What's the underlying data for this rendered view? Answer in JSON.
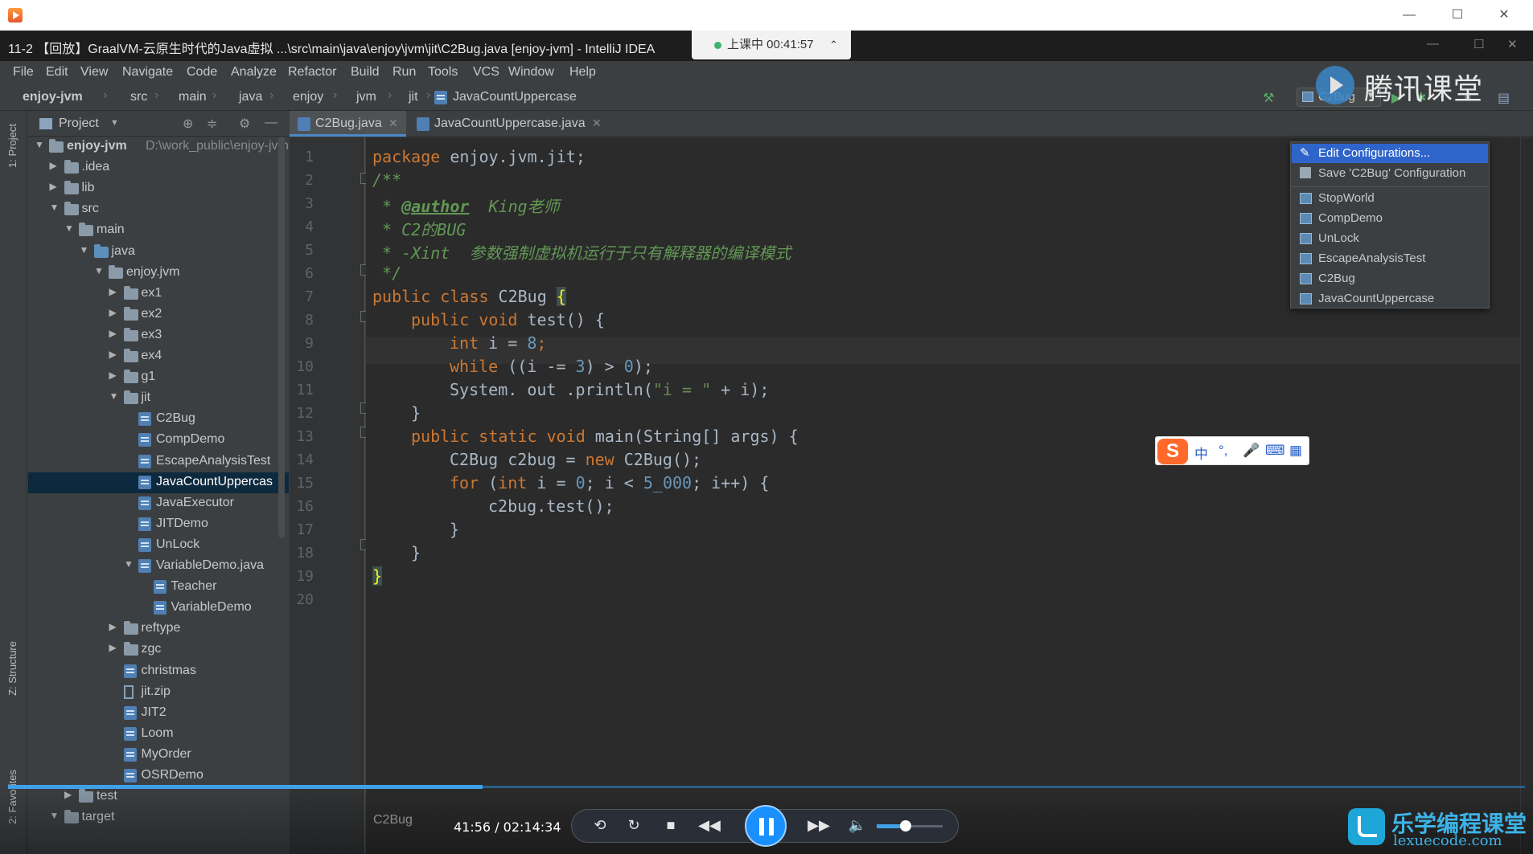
{
  "player": {
    "window_controls": {
      "minimize": "—",
      "maximize": "☐",
      "close": "✕"
    },
    "time": "41:56 / 02:14:34",
    "progress_fraction": 0.313,
    "volume_fraction": 0.44,
    "file_label": "C2Bug"
  },
  "ide": {
    "title": "11-2 【回放】GraalVM-云原生时代的Java虚拟 ...\\src\\main\\java\\enjoy\\jvm\\jit\\C2Bug.java [enjoy-jvm] - IntelliJ IDEA",
    "live_badge": "上课中 00:41:57",
    "menu": [
      "File",
      "Edit",
      "View",
      "Navigate",
      "Code",
      "Analyze",
      "Refactor",
      "Build",
      "Run",
      "Tools",
      "VCS",
      "Window",
      "Help"
    ],
    "breadcrumb": [
      "enjoy-jvm",
      "src",
      "main",
      "java",
      "enjoy",
      "jvm",
      "jit",
      "JavaCountUppercase"
    ],
    "run_config": "C2Bug",
    "left_tabs": {
      "project": "1: Project",
      "structure": "Z: Structure",
      "favorites": "2: Favorites"
    },
    "project_title": "Project",
    "tree": [
      {
        "label": "enjoy-jvm",
        "path": "D:\\work_public\\enjoy-jvm",
        "depth": 0,
        "arrow": "open",
        "icon": "folder",
        "bold": true
      },
      {
        "label": ".idea",
        "depth": 1,
        "arrow": "closed",
        "icon": "folder"
      },
      {
        "label": "lib",
        "depth": 1,
        "arrow": "closed",
        "icon": "folder"
      },
      {
        "label": "src",
        "depth": 1,
        "arrow": "open",
        "icon": "folder"
      },
      {
        "label": "main",
        "depth": 2,
        "arrow": "open",
        "icon": "folder"
      },
      {
        "label": "java",
        "depth": 3,
        "arrow": "open",
        "icon": "folder-blue"
      },
      {
        "label": "enjoy.jvm",
        "depth": 4,
        "arrow": "open",
        "icon": "folder"
      },
      {
        "label": "ex1",
        "depth": 5,
        "arrow": "closed",
        "icon": "folder"
      },
      {
        "label": "ex2",
        "depth": 5,
        "arrow": "closed",
        "icon": "folder"
      },
      {
        "label": "ex3",
        "depth": 5,
        "arrow": "closed",
        "icon": "folder"
      },
      {
        "label": "ex4",
        "depth": 5,
        "arrow": "closed",
        "icon": "folder"
      },
      {
        "label": "g1",
        "depth": 5,
        "arrow": "closed",
        "icon": "folder"
      },
      {
        "label": "jit",
        "depth": 5,
        "arrow": "open",
        "icon": "folder"
      },
      {
        "label": "C2Bug",
        "depth": 6,
        "icon": "class"
      },
      {
        "label": "CompDemo",
        "depth": 6,
        "icon": "class"
      },
      {
        "label": "EscapeAnalysisTest",
        "depth": 6,
        "icon": "class"
      },
      {
        "label": "JavaCountUppercas",
        "depth": 6,
        "icon": "class",
        "selected": true
      },
      {
        "label": "JavaExecutor",
        "depth": 6,
        "icon": "class"
      },
      {
        "label": "JITDemo",
        "depth": 6,
        "icon": "class"
      },
      {
        "label": "UnLock",
        "depth": 6,
        "icon": "class"
      },
      {
        "label": "VariableDemo.java",
        "depth": 6,
        "arrow": "open",
        "icon": "class"
      },
      {
        "label": "Teacher",
        "depth": 7,
        "icon": "class"
      },
      {
        "label": "VariableDemo",
        "depth": 7,
        "icon": "class"
      },
      {
        "label": "reftype",
        "depth": 5,
        "arrow": "closed",
        "icon": "folder"
      },
      {
        "label": "zgc",
        "depth": 5,
        "arrow": "closed",
        "icon": "folder"
      },
      {
        "label": "christmas",
        "depth": 5,
        "icon": "class"
      },
      {
        "label": "jit.zip",
        "depth": 5,
        "icon": "zip"
      },
      {
        "label": "JIT2",
        "depth": 5,
        "icon": "class"
      },
      {
        "label": "Loom",
        "depth": 5,
        "icon": "class"
      },
      {
        "label": "MyOrder",
        "depth": 5,
        "icon": "class"
      },
      {
        "label": "OSRDemo",
        "depth": 5,
        "icon": "class"
      },
      {
        "label": "test",
        "depth": 2,
        "arrow": "closed",
        "icon": "folder"
      },
      {
        "label": "target",
        "depth": 1,
        "arrow": "open",
        "icon": "folder"
      }
    ],
    "tabs": [
      {
        "label": "C2Bug.java",
        "active": true
      },
      {
        "label": "JavaCountUppercase.java",
        "active": false
      }
    ],
    "line_numbers": [
      "1",
      "2",
      "3",
      "4",
      "5",
      "6",
      "7",
      "8",
      "9",
      "10",
      "11",
      "12",
      "13",
      "14",
      "15",
      "16",
      "17",
      "18",
      "19",
      "20"
    ],
    "code": {
      "l1_kw": "package",
      "l1_rest": " enjoy.jvm.jit;",
      "l2": "/**",
      "l3_star": " * ",
      "l3_tag": "@author",
      "l3_rest": "  King老师",
      "l4": " * C2的BUG",
      "l5": " * -Xint  参数强制虚拟机运行于只有解释器的编译模式",
      "l6": " */",
      "l7_kw": "public class",
      "l7_name": " C2Bug ",
      "l7_brace": "{",
      "l8_kw": "public void",
      "l8_rest": " test() {",
      "l9_kw": "int",
      "l9_a": " i = ",
      "l9_num": "8",
      "l9_semi": ";",
      "l10_kw": "while",
      "l10_a": " ((i -= ",
      "l10_n1": "3",
      "l10_b": ") > ",
      "l10_n2": "0",
      "l10_c": ");",
      "l11_a": "System. out .println(",
      "l11_str": "\"i = \"",
      "l11_b": " + i);",
      "l12": "}",
      "l13_kw": "public static void",
      "l13_rest": " main(String[] args) {",
      "l14_a": "C2Bug c2bug = ",
      "l14_kw": "new",
      "l14_b": " C2Bug();",
      "l15_kw": "for",
      "l15_a": " (",
      "l15_kw2": "int",
      "l15_b": " i = ",
      "l15_n1": "0",
      "l15_c": "; i < ",
      "l15_n2": "5_000",
      "l15_d": "; i++) {",
      "l16": "c2bug.test();",
      "l17": "}",
      "l18": "}",
      "l19": "}"
    },
    "popup": {
      "edit": "Edit Configurations...",
      "save": "Save 'C2Bug' Configuration",
      "items": [
        "StopWorld",
        "CompDemo",
        "UnLock",
        "EscapeAnalysisTest",
        "C2Bug",
        "JavaCountUppercase"
      ]
    }
  },
  "ime": {
    "lang": "中",
    "punct": "°,",
    "mic": "🎤",
    "keyboard": "⌨",
    "grid": "▦"
  },
  "watermarks": {
    "tencent": "腾讯课堂",
    "lexue_cn": "乐学编程课堂",
    "lexue_en": "lexuecode.com"
  },
  "icons": [
    "app-icon",
    "minimize-icon",
    "maximize-icon",
    "close-icon",
    "hammer-icon",
    "run-icon",
    "debug-icon",
    "coverage-icon",
    "stop-icon",
    "folder-icon",
    "class-icon",
    "gear-icon",
    "collapse-icon",
    "locate-icon",
    "play-icon",
    "pause-icon",
    "rewind-icon",
    "forward-icon",
    "volume-icon",
    "loop-icon",
    "stop-icon"
  ]
}
